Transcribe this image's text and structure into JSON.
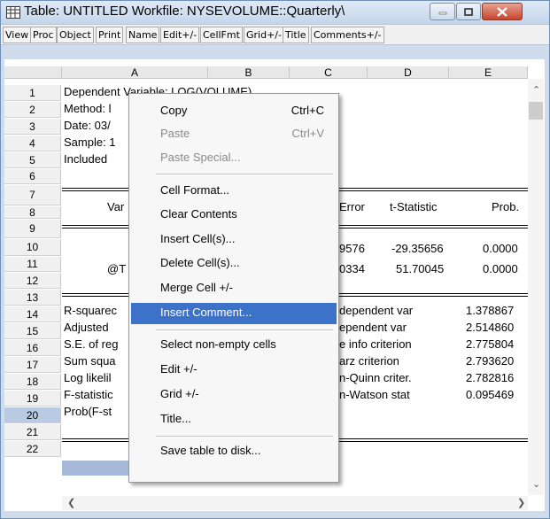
{
  "window": {
    "title": "Table: UNTITLED   Workfile: NYSEVOLUME::Quarterly\\",
    "icon": "table-icon",
    "buttons": [
      "minimize-icon",
      "maximize-icon",
      "close-icon"
    ]
  },
  "toolbar": {
    "buttons": [
      "View",
      "Proc",
      "Object",
      "Print",
      "Name",
      "Edit+/-",
      "CellFmt",
      "Grid+/-",
      "Title",
      "Comments+/-"
    ]
  },
  "columns": [
    "A",
    "B",
    "C",
    "D",
    "E"
  ],
  "rows": [
    "1",
    "2",
    "3",
    "4",
    "5",
    "6",
    "7",
    "8",
    "9",
    "10",
    "11",
    "12",
    "13",
    "14",
    "15",
    "16",
    "17",
    "18",
    "19",
    "20",
    "21",
    "22"
  ],
  "cells": {
    "r1": "Dependent Variable: LOG(VOLUME)",
    "r2": "Method: l",
    "r3": "Date: 03/",
    "r4": "Sample: 1",
    "r5": "Included",
    "r7a": "Var",
    "r7c": "Error",
    "r7d": "t-Statistic",
    "r7e": "Prob.",
    "r9c": "9576",
    "r9d": "-29.35656",
    "r9e": "0.0000",
    "r10a": "@T",
    "r10c": "0334",
    "r10d": "51.70045",
    "r10e": "0.0000",
    "r12a": "R-squarec",
    "r12d": "dependent var",
    "r12e": "1.378867",
    "r13a": "Adjusted",
    "r13d": "ependent var",
    "r13e": "2.514860",
    "r14a": "S.E. of reg",
    "r14d": "e info criterion",
    "r14e": "2.775804",
    "r15a": "Sum squa",
    "r15d": "arz criterion",
    "r15e": "2.793620",
    "r16a": "Log likelil",
    "r16d": "n-Quinn criter.",
    "r16e": "2.782816",
    "r17a": "F-statistic",
    "r17d": "n-Watson stat",
    "r17e": "0.095469",
    "r18a": "Prob(F-st"
  },
  "context_menu": {
    "items": [
      {
        "label": "Copy",
        "shortcut": "Ctrl+C",
        "disabled": false
      },
      {
        "label": "Paste",
        "shortcut": "Ctrl+V",
        "disabled": true
      },
      {
        "label": "Paste Special...",
        "shortcut": "",
        "disabled": true
      },
      {
        "label": "Cell Format...",
        "shortcut": "",
        "disabled": false
      },
      {
        "label": "Clear Contents",
        "shortcut": "",
        "disabled": false
      },
      {
        "label": "Insert Cell(s)...",
        "shortcut": "",
        "disabled": false
      },
      {
        "label": "Delete Cell(s)...",
        "shortcut": "",
        "disabled": false
      },
      {
        "label": "Merge Cell +/-",
        "shortcut": "",
        "disabled": false
      },
      {
        "label": "Insert Comment...",
        "shortcut": "",
        "disabled": false,
        "highlighted": true
      },
      {
        "label": "Select non-empty cells",
        "shortcut": "",
        "disabled": false
      },
      {
        "label": "Edit +/-",
        "shortcut": "",
        "disabled": false
      },
      {
        "label": "Grid +/-",
        "shortcut": "",
        "disabled": false
      },
      {
        "label": "Title...",
        "shortcut": "",
        "disabled": false
      },
      {
        "label": "Save table to disk...",
        "shortcut": "",
        "disabled": false
      }
    ]
  },
  "colors": {
    "menu_highlight": "#3c73c9",
    "selection": "#a7b9d8",
    "close_button": "#c7442a"
  }
}
